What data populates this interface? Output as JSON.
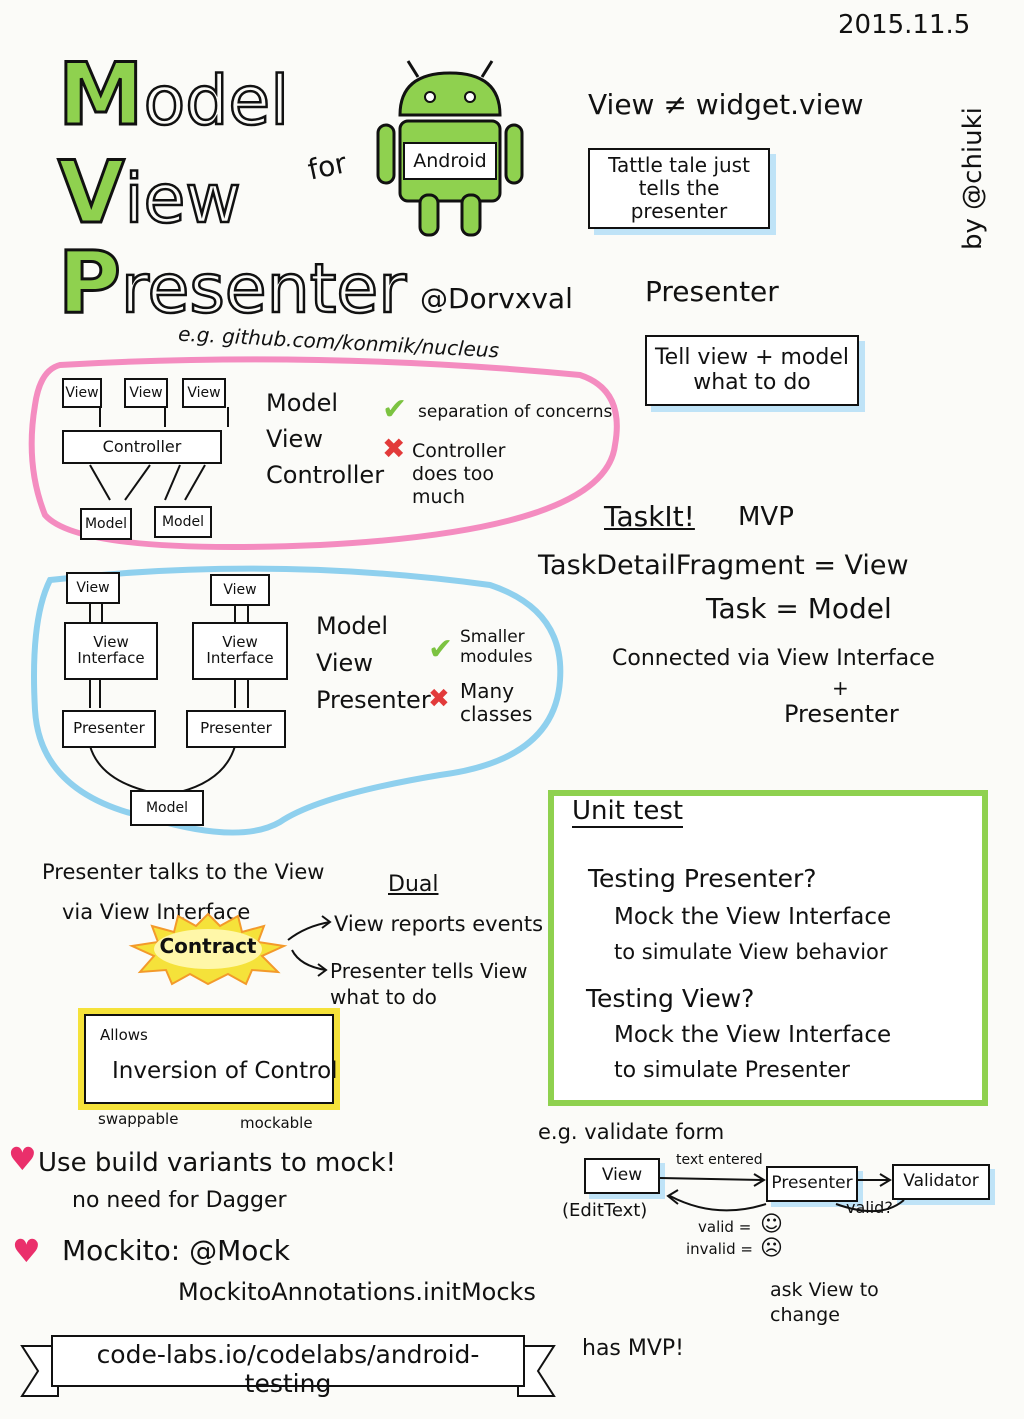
{
  "date": "2015.11.5",
  "author": "by @chiuki",
  "title": {
    "model": {
      "first": "M",
      "rest": "odel"
    },
    "view": {
      "first": "V",
      "rest": "iew"
    },
    "presenter": {
      "first": "P",
      "rest": "resenter"
    },
    "for": "for",
    "android": "Android"
  },
  "speaker": "@Dorvxval",
  "example_link": "e.g. github.com/konmik/nucleus",
  "view_note": {
    "heading": "View ≠ widget.view",
    "bubble": "Tattle tale just tells the presenter"
  },
  "presenter_note": {
    "heading": "Presenter",
    "bubble": "Tell view + model what to do"
  },
  "mvc": {
    "views": [
      "View",
      "View",
      "View"
    ],
    "controller": "Controller",
    "models": [
      "Model",
      "Model"
    ],
    "label": [
      "Model",
      "View",
      "Controller"
    ],
    "pro": "separation of concerns",
    "con": "Controller does too much"
  },
  "mvp": {
    "views": [
      "View",
      "View"
    ],
    "interfaces": [
      "View Interface",
      "View Interface"
    ],
    "presenters": [
      "Presenter",
      "Presenter"
    ],
    "model": "Model",
    "label": [
      "Model",
      "View",
      "Presenter"
    ],
    "pro": "Smaller modules",
    "con": "Many classes"
  },
  "taskit": {
    "title": "TaskIt!",
    "subtitle": "MVP",
    "line1": "TaskDetailFragment = View",
    "line2": "Task = Model",
    "line3": "Connected via View Interface",
    "plus": "+",
    "line4": "Presenter"
  },
  "contract": {
    "line1": "Presenter talks to the View",
    "line2": "via View Interface",
    "burst": "Contract",
    "dual": "Dual",
    "arrow1": "View reports events",
    "arrow2": "Presenter tells View what to do"
  },
  "ioc": {
    "allows": "Allows",
    "main": "Inversion of Control",
    "left": "swappable",
    "right": "mockable"
  },
  "unit_test": {
    "title": "Unit test",
    "q1": "Testing Presenter?",
    "a1_1": "Mock the View Interface",
    "a1_2": "to simulate View behavior",
    "q2": "Testing View?",
    "a2_1": "Mock the View Interface",
    "a2_2": "to simulate Presenter"
  },
  "validate": {
    "title": "e.g. validate form",
    "view": "View",
    "view_sub": "(EditText)",
    "text_entered": "text entered",
    "presenter": "Presenter",
    "validator": "Validator",
    "valid_q": "valid?",
    "valid": "valid =",
    "invalid": "invalid =",
    "ask": "ask View to change"
  },
  "tips": {
    "tip1": "Use build variants to mock!",
    "tip1_sub": "no need for Dagger",
    "tip2": "Mockito: @Mock",
    "tip2_sub": "MockitoAnnotations.initMocks"
  },
  "banner": {
    "url": "code-labs.io/codelabs/android-testing",
    "note": "has MVP!"
  },
  "colors": {
    "green": "#8fd14f",
    "pink": "#f48cc0",
    "blue": "#8fd0ee",
    "yellow": "#f5e23a",
    "check": "#7cc341",
    "cross": "#e23a3a",
    "heart": "#ea2f6b"
  }
}
